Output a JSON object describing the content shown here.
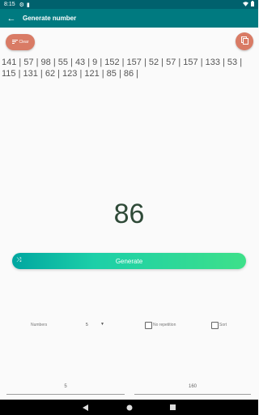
{
  "status": {
    "time": "8:15",
    "icons": [
      "gear-icon",
      "sim-icon",
      "wifi-icon",
      "battery-icon"
    ]
  },
  "app_bar": {
    "title": "Generate number",
    "back_icon": "arrow-left-icon"
  },
  "actions": {
    "clear_label": "Clear",
    "clear_icon": "clear-icon",
    "copy_icon": "copy-icon"
  },
  "history": "141 | 57 | 98 | 55 | 43 | 9 | 152 | 157 | 52 | 57 | 157 | 133 | 53 | 115 | 131 | 62 | 123 | 121 | 85 | 86 |",
  "result": "86",
  "generate": {
    "label": "Generate",
    "icon": "shuffle-icon"
  },
  "options": {
    "numbers_label": "Numbers",
    "numbers_value": "5",
    "no_repetition_label": "No repetition",
    "sort_label": "Sort"
  },
  "range": {
    "min": "5",
    "max": "160"
  },
  "colors": {
    "status_bar": "#00616d",
    "app_bar": "#007a80",
    "accent_button": "#d97b65",
    "generate_start": "#00a6a0",
    "generate_end": "#3ee08a",
    "result_text": "#2f4a38"
  }
}
